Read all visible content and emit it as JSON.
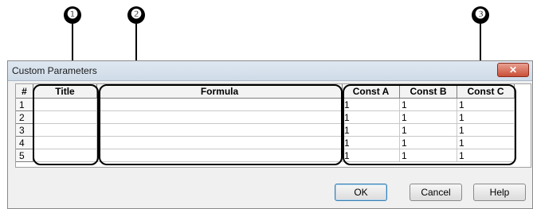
{
  "callouts": [
    "❶",
    "❷",
    "❸"
  ],
  "dialog": {
    "title": "Custom Parameters",
    "close_icon": "✕"
  },
  "grid": {
    "headers": [
      "#",
      "Title",
      "Formula",
      "Const A",
      "Const B",
      "Const C"
    ],
    "rows": [
      {
        "num": "1",
        "title": "",
        "formula": "",
        "a": "1",
        "b": "1",
        "c": "1"
      },
      {
        "num": "2",
        "title": "",
        "formula": "",
        "a": "1",
        "b": "1",
        "c": "1"
      },
      {
        "num": "3",
        "title": "",
        "formula": "",
        "a": "1",
        "b": "1",
        "c": "1"
      },
      {
        "num": "4",
        "title": "",
        "formula": "",
        "a": "1",
        "b": "1",
        "c": "1"
      },
      {
        "num": "5",
        "title": "",
        "formula": "",
        "a": "1",
        "b": "1",
        "c": "1"
      }
    ]
  },
  "buttons": {
    "ok": "OK",
    "cancel": "Cancel",
    "help": "Help"
  }
}
